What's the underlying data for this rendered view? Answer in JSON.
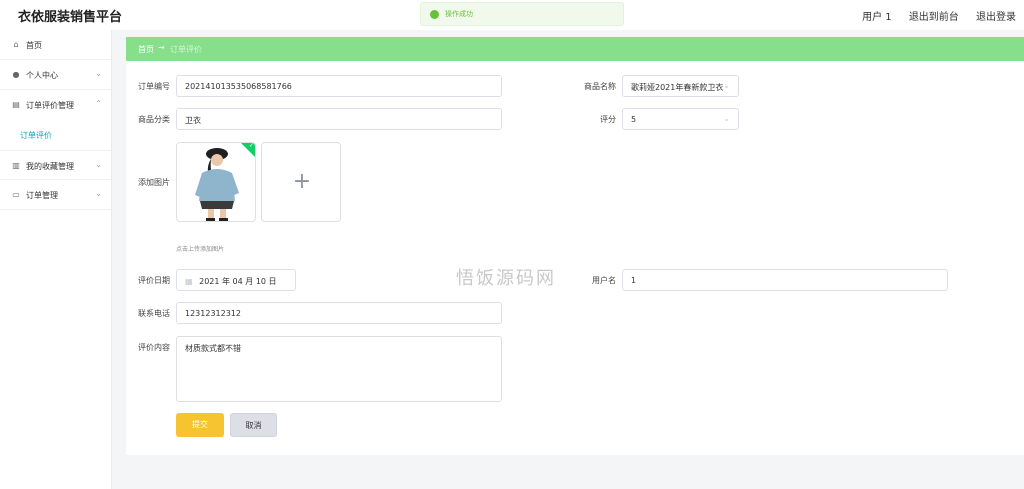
{
  "app": {
    "title": "衣依服装销售平台"
  },
  "top_nav": {
    "user": "用户 1",
    "back_to_front": "退出到前台",
    "logout": "退出登录"
  },
  "toast": {
    "message": "操作成功"
  },
  "sidebar": {
    "items": [
      {
        "label": "首页",
        "icon": "home-icon"
      },
      {
        "label": "个人中心",
        "icon": "user-icon"
      },
      {
        "label": "订单评价管理",
        "icon": "shop-icon"
      },
      {
        "label": "订单评价",
        "icon": ""
      },
      {
        "label": "我的收藏管理",
        "icon": "chart-icon"
      },
      {
        "label": "订单管理",
        "icon": "card-icon"
      }
    ]
  },
  "breadcrumb": {
    "home": "首页",
    "separator": "→",
    "current": "订单评价"
  },
  "form": {
    "order_no_label": "订单编号",
    "order_no": "20214101353506858176​6",
    "product_name_label": "商品名称",
    "product_name": "歌莉娅2021年春新款卫衣",
    "category_label": "商品分类",
    "category": "卫衣",
    "rating_label": "评分",
    "rating": "5",
    "image_label": "添加图片",
    "image_hint": "点击上传添加图片",
    "date_label": "评价日期",
    "date": "2021 年 04 月 10 日",
    "username_label": "用户名",
    "username": "1",
    "phone_label": "联系电话",
    "phone": "12312312312",
    "content_label": "评价内容",
    "content": "材质款式都不错",
    "submit_label": "提交",
    "cancel_label": "取消"
  },
  "watermark": "悟饭源码网",
  "colors": {
    "accent": "#87de8b",
    "primary_button": "#f7c431",
    "link": "#18a0c8",
    "success": "#13ce66"
  }
}
